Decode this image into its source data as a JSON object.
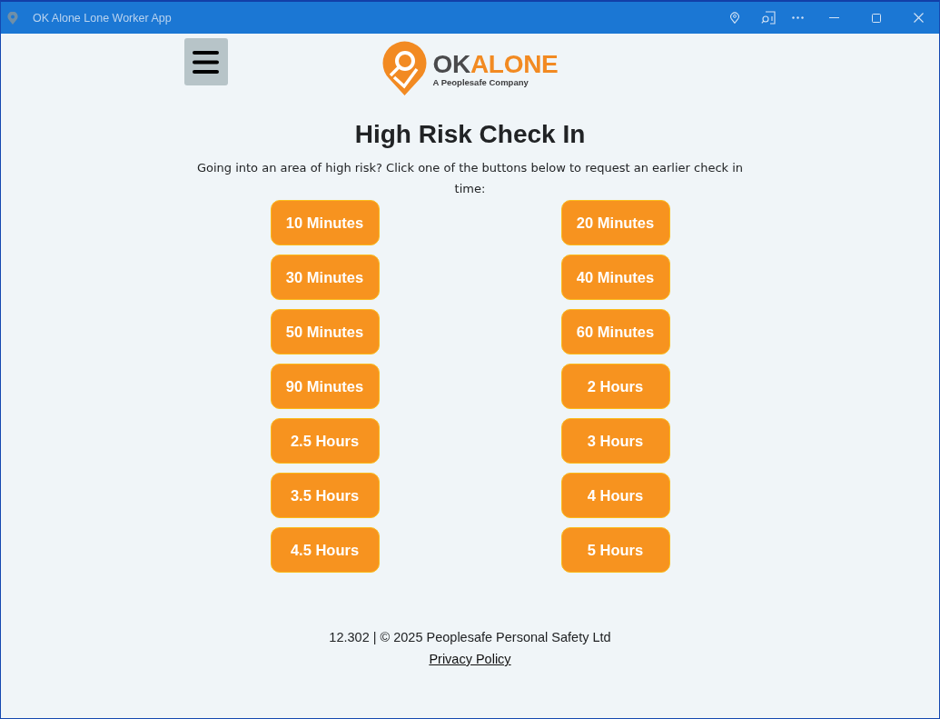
{
  "window": {
    "title": "OK Alone Lone Worker App"
  },
  "logo": {
    "wordmark_dark": "OK",
    "wordmark_accent": "ALONE",
    "tagline": "A Peoplesafe Company"
  },
  "heading": "High Risk Check In",
  "intro": "Going into an area of high risk? Click one of the buttons below to request an earlier check in time:",
  "check_in_buttons": [
    {
      "label": "10 Minutes"
    },
    {
      "label": "20 Minutes"
    },
    {
      "label": "30 Minutes"
    },
    {
      "label": "40 Minutes"
    },
    {
      "label": "50 Minutes"
    },
    {
      "label": "60 Minutes"
    },
    {
      "label": "90 Minutes"
    },
    {
      "label": "2 Hours"
    },
    {
      "label": "2.5 Hours"
    },
    {
      "label": "3 Hours"
    },
    {
      "label": "3.5 Hours"
    },
    {
      "label": "4 Hours"
    },
    {
      "label": "4.5 Hours"
    },
    {
      "label": "5 Hours"
    }
  ],
  "footer": {
    "copyright": "12.302 | © 2025 Peoplesafe Personal Safety Ltd",
    "link": "Privacy Policy"
  }
}
